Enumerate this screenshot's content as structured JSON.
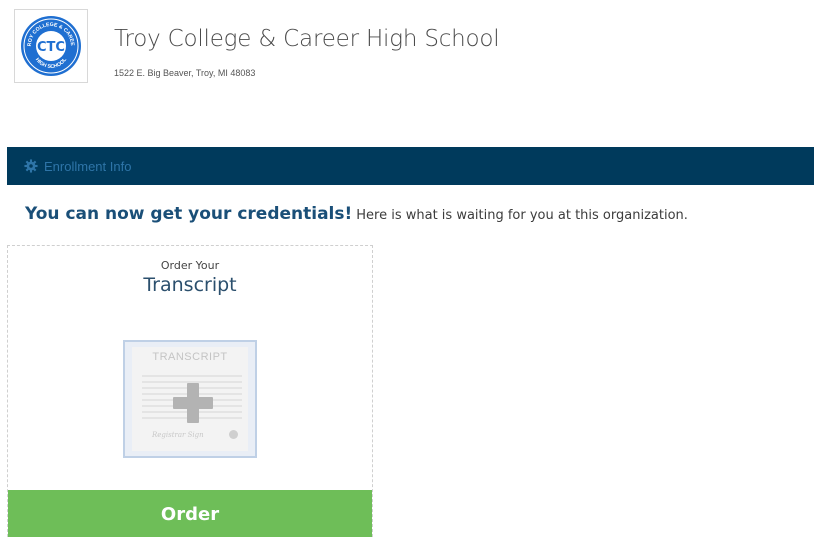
{
  "header": {
    "logo_text_top": "TROY COLLEGE & CAREER",
    "logo_text_bottom": "HIGH SCHOOL",
    "logo_monogram": "CTC",
    "school_name": "Troy College & Career High School",
    "address": "1522 E. Big Beaver, Troy, MI 48083"
  },
  "enrollment_bar": {
    "icon": "gear-icon",
    "label": "Enrollment Info"
  },
  "credentials": {
    "headline": "You can now get your credentials!",
    "subtext": "Here is what is waiting for you at this organization."
  },
  "card": {
    "small_label": "Order Your",
    "title": "Transcript",
    "graphic_title": "TRANSCRIPT",
    "graphic_signature": "Registrar Sign",
    "icon": "plus-icon",
    "order_label": "Order"
  },
  "colors": {
    "bar_background": "#003a5c",
    "bar_text": "#2e75a8",
    "headline": "#1a4f78",
    "order_button": "#6ebe58",
    "logo_blue": "#1f6fd1"
  }
}
